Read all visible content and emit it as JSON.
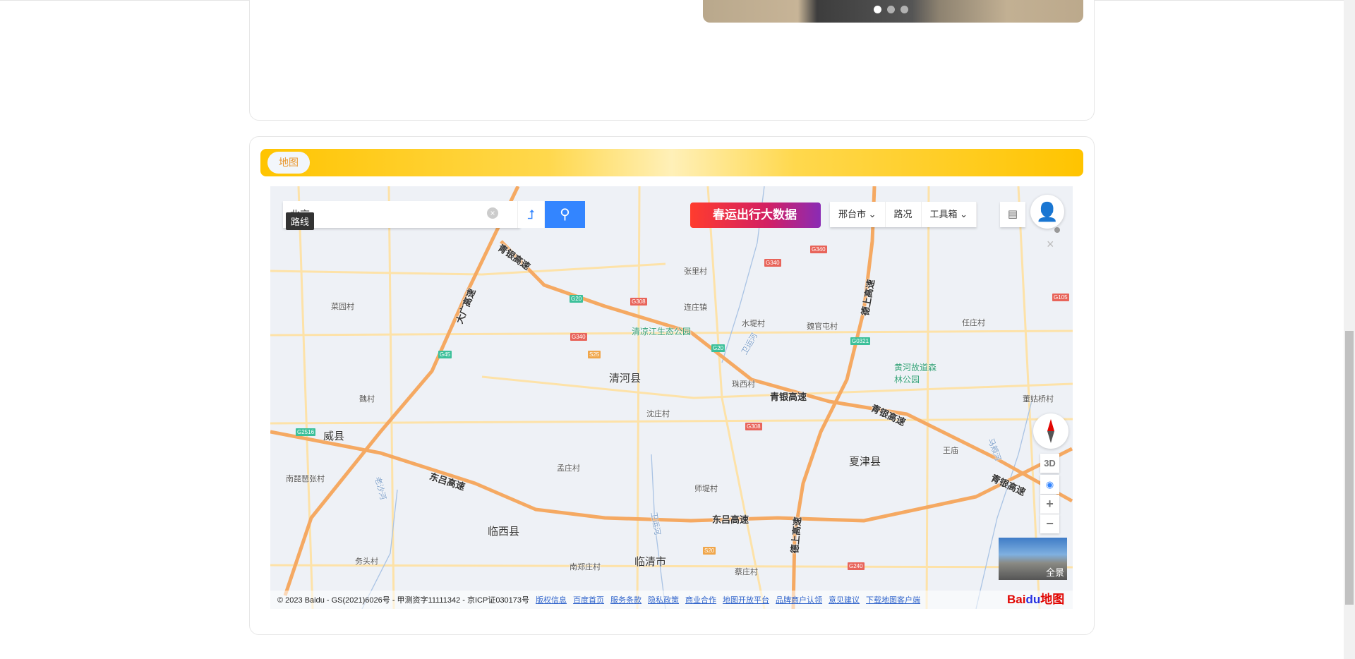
{
  "carousel": {
    "slides": 3,
    "active": 0
  },
  "section": {
    "title": "地图"
  },
  "map": {
    "search": {
      "value": "北京",
      "tooltip": "路线",
      "clear": "×",
      "route_icon": "route-icon",
      "search_icon": "search-icon"
    },
    "banner": "春运出行大数据",
    "toolbar": {
      "city": "邢台市 ⌄",
      "traffic": "路况",
      "tools": "工具箱 ⌄"
    },
    "controls": {
      "three_d": "3D",
      "zoom_in": "+",
      "zoom_out": "−",
      "panorama": "全景",
      "close": "×"
    },
    "labels": [
      "青银高速",
      "大广高速",
      "菜园村",
      "魏村",
      "清凉江生态公园",
      "张里村",
      "连庄镇",
      "水堤村",
      "魏官屯村",
      "任庄村",
      "德上高速",
      "清河县",
      "珠西村",
      "青银高速",
      "黄河故道森林公园",
      "青银高速",
      "董姑桥村",
      "沈庄村",
      "威县",
      "夏津县",
      "王庙",
      "南琵琶张村",
      "东吕高速",
      "孟庄村",
      "师堤村",
      "青银高速",
      "临西县",
      "东吕高速",
      "临清市",
      "南郑庄村",
      "蔡庄村",
      "务头村",
      "卫运河",
      "老沙河",
      "马颊河",
      "卫运河",
      "德上高速"
    ],
    "shields": [
      "G20",
      "G308",
      "G340",
      "S25",
      "G45",
      "G2516",
      "G308",
      "G20",
      "G0321",
      "G340",
      "G340",
      "G105",
      "S20",
      "G240"
    ],
    "footer": {
      "copyright": "© 2023 Baidu - GS(2021)6026号 - 甲测资字11111342 - 京ICP证030173号",
      "links": [
        "版权信息",
        "百度首页",
        "服务条款",
        "隐私政策",
        "商业合作",
        "地图开放平台",
        "品牌商户认领",
        "意见建议",
        "下载地图客户端"
      ],
      "logo_a": "Bai",
      "logo_b": "du",
      "logo_c": "地图"
    }
  },
  "colors": {
    "accent": "#ffc400",
    "map_blue": "#3385ff",
    "highway": "#f5a962"
  }
}
